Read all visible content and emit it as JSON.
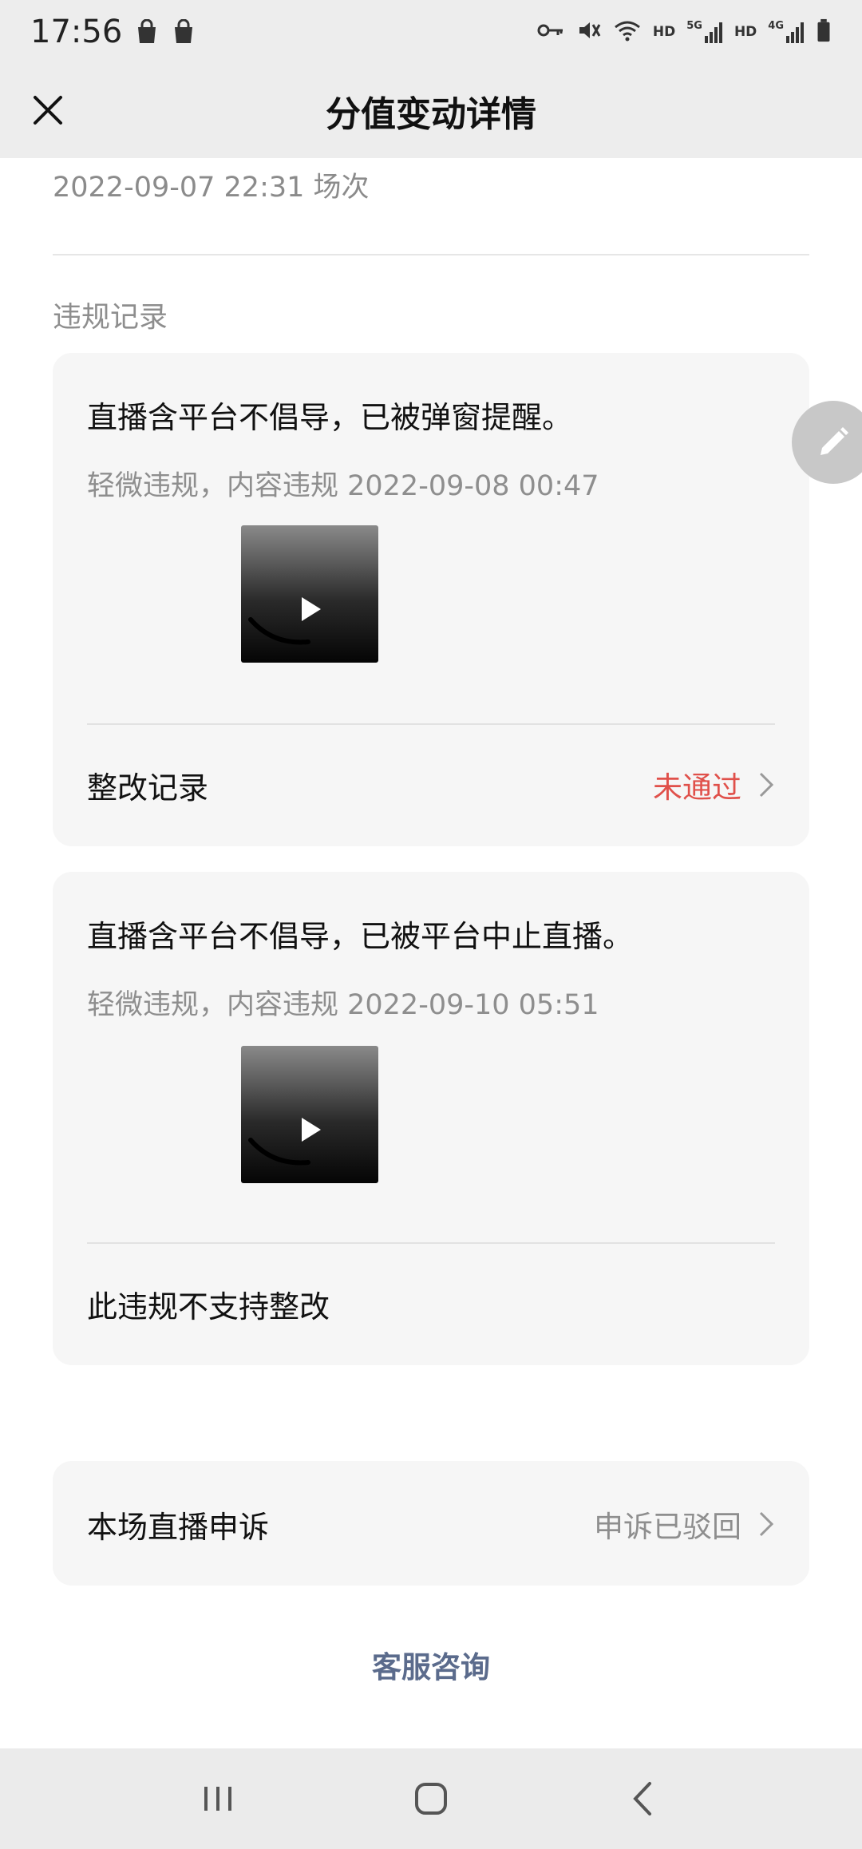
{
  "status_bar": {
    "time": "17:56",
    "icons": [
      "shopping-bag-icon",
      "shopping-bag-icon",
      "key-icon",
      "mute-icon",
      "wifi-icon",
      "signal-icon",
      "battery-icon"
    ],
    "hd_label_1": "HD",
    "hd_label_2": "HD",
    "net_1": "5G",
    "net_2": "4G"
  },
  "header": {
    "title": "分值变动详情",
    "close_icon": "close-icon"
  },
  "session": {
    "text": "2022-09-07 22:31 场次"
  },
  "section": {
    "label": "违规记录"
  },
  "violations": [
    {
      "title": "直播含平台不倡导，已被弹窗提醒。",
      "meta": "轻微违规，内容违规  2022-09-08 00:47",
      "row_label": "整改记录",
      "row_status": "未通过"
    },
    {
      "title": "直播含平台不倡导，已被平台中止直播。",
      "meta": "轻微违规，内容违规  2022-09-10 05:51",
      "row_label": "此违规不支持整改"
    }
  ],
  "appeal": {
    "label": "本场直播申诉",
    "status": "申诉已驳回"
  },
  "service": {
    "label": "客服咨询"
  },
  "colors": {
    "fail": "#e0504a",
    "link": "#5b6b8c",
    "card_bg": "#f6f6f6",
    "header_bg": "#ededed"
  }
}
